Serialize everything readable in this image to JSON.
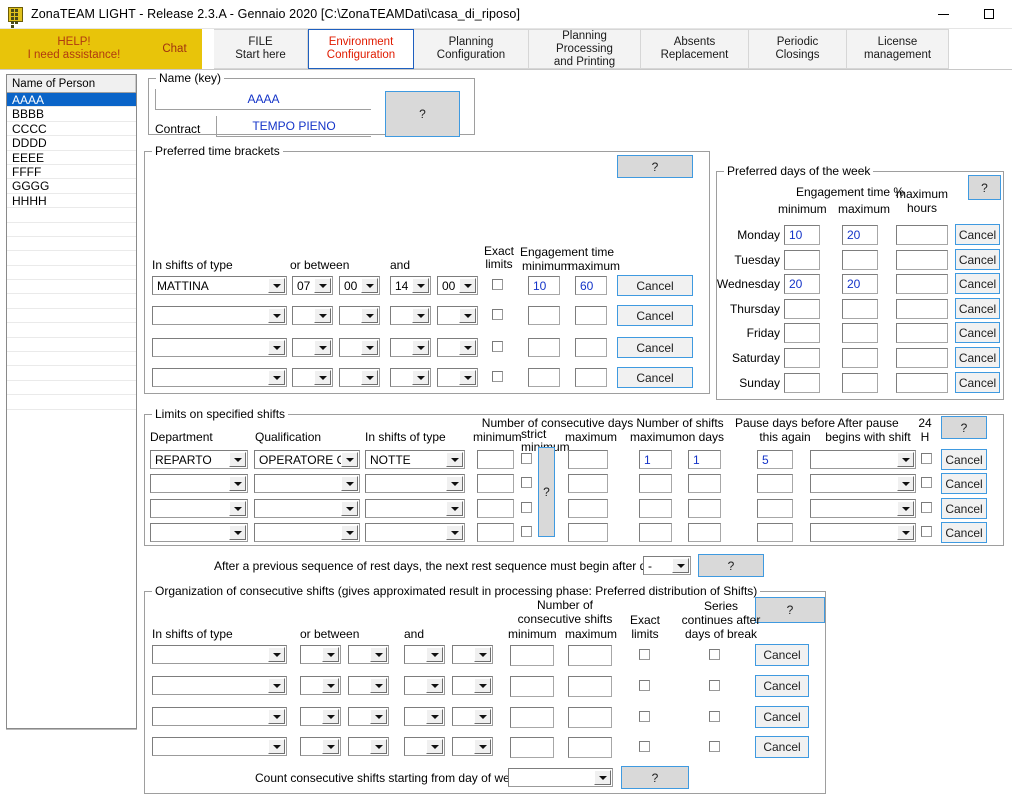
{
  "window": {
    "title": "ZonaTEAM LIGHT - Release 2.3.A - Gennaio 2020 [C:\\ZonaTEAMDati\\casa_di_riposo]",
    "icon": "app-icon",
    "minimize": "minimize-icon",
    "maximize": "maximize-icon"
  },
  "tabs": [
    {
      "label": "HELP!\nI need assistance!",
      "style": "gold"
    },
    {
      "label": "Chat",
      "style": "gold"
    },
    {
      "label": "FILE\nStart here",
      "style": "normal"
    },
    {
      "label": "Environment\nConfiguration",
      "style": "active"
    },
    {
      "label": "Planning Configuration",
      "style": "normal"
    },
    {
      "label": "Planning Processing\nand Printing",
      "style": "normal"
    },
    {
      "label": "Absents Replacement",
      "style": "normal"
    },
    {
      "label": "Periodic Closings",
      "style": "normal"
    },
    {
      "label": "License\nmanagement",
      "style": "normal"
    }
  ],
  "person_list": {
    "header": "Name of Person",
    "items": [
      "AAAA",
      "BBBB",
      "CCCC",
      "DDDD",
      "EEEE",
      "FFFF",
      "GGGG",
      "HHHH"
    ],
    "selected": "AAAA",
    "empty_rows": 14
  },
  "name_key": {
    "title": "Name (key)",
    "name_value": "AAAA",
    "contract_label": "Contract",
    "contract_value": "TEMPO PIENO",
    "help": "?"
  },
  "preferred_time_brackets": {
    "title": "Preferred time brackets",
    "help": "?",
    "headers": {
      "shift_type": "In shifts of type",
      "or_between": "or between",
      "and": "and",
      "exact_limits": "Exact\nlimits",
      "engagement_time": "Engagement time",
      "minimum": "minimum",
      "maximum": "maximum"
    },
    "cancel_label": "Cancel",
    "rows": [
      {
        "shift_type": "MATTINA",
        "from_h": "07",
        "from_m": "00",
        "to_h": "14",
        "to_m": "00",
        "exact": false,
        "min": "10",
        "max": "60"
      },
      {
        "shift_type": "",
        "from_h": "",
        "from_m": "",
        "to_h": "",
        "to_m": "",
        "exact": false,
        "min": "",
        "max": ""
      },
      {
        "shift_type": "",
        "from_h": "",
        "from_m": "",
        "to_h": "",
        "to_m": "",
        "exact": false,
        "min": "",
        "max": ""
      },
      {
        "shift_type": "",
        "from_h": "",
        "from_m": "",
        "to_h": "",
        "to_m": "",
        "exact": false,
        "min": "",
        "max": ""
      }
    ]
  },
  "preferred_days": {
    "title": "Preferred days of the week",
    "help": "?",
    "headers": {
      "engagement_pct": "Engagement time %",
      "minimum": "minimum",
      "maximum": "maximum",
      "max_hours": "maximum\nhours"
    },
    "cancel_label": "Cancel",
    "rows": [
      {
        "day": "Monday",
        "min": "10",
        "max": "20",
        "hours": ""
      },
      {
        "day": "Tuesday",
        "min": "",
        "max": "",
        "hours": ""
      },
      {
        "day": "Wednesday",
        "min": "20",
        "max": "20",
        "hours": ""
      },
      {
        "day": "Thursday",
        "min": "",
        "max": "",
        "hours": ""
      },
      {
        "day": "Friday",
        "min": "",
        "max": "",
        "hours": ""
      },
      {
        "day": "Saturday",
        "min": "",
        "max": "",
        "hours": ""
      },
      {
        "day": "Sunday",
        "min": "",
        "max": "",
        "hours": ""
      }
    ]
  },
  "limits_on_shifts": {
    "title": "Limits on specified shifts",
    "help": "?",
    "help_strict": "?",
    "headers": {
      "department": "Department",
      "qualification": "Qualification",
      "shift_type": "In shifts of type",
      "consecutive_days": "Number of consecutive days",
      "cd_minimum": "minimum",
      "strict_minimum": "strict\nminimum",
      "cd_maximum": "maximum",
      "number_of_shifts": "Number of shifts",
      "ns_maximum": "maximum",
      "ns_on_days": "on days",
      "pause_days": "Pause days before\nthis again",
      "after_pause": "After pause\nbegins with shift",
      "h24": "24\nH"
    },
    "cancel_label": "Cancel",
    "rows": [
      {
        "department": "REPARTO",
        "qualification": "OPERATORE OSS",
        "shift_type": "NOTTE",
        "cd_min": "",
        "strict": false,
        "cd_max": "",
        "ns_max": "1",
        "ns_days": "1",
        "pause": "5",
        "after_pause": "",
        "h24": false
      },
      {
        "department": "",
        "qualification": "",
        "shift_type": "",
        "cd_min": "",
        "strict": false,
        "cd_max": "",
        "ns_max": "",
        "ns_days": "",
        "pause": "",
        "after_pause": "",
        "h24": false
      },
      {
        "department": "",
        "qualification": "",
        "shift_type": "",
        "cd_min": "",
        "strict": false,
        "cd_max": "",
        "ns_max": "",
        "ns_days": "",
        "pause": "",
        "after_pause": "",
        "h24": false
      },
      {
        "department": "",
        "qualification": "",
        "shift_type": "",
        "cd_min": "",
        "strict": false,
        "cd_max": "",
        "ns_max": "",
        "ns_days": "",
        "pause": "",
        "after_pause": "",
        "h24": false
      }
    ]
  },
  "rest_sequence": {
    "label": "After a previous sequence of rest days, the next rest sequence must begin after days",
    "value": "-",
    "help": "?"
  },
  "consecutive_shifts": {
    "title": "Organization of consecutive shifts (gives approximated result in processing phase: Preferred distribution of Shifts)",
    "help": "?",
    "headers": {
      "shift_type": "In shifts of type",
      "or_between": "or between",
      "and": "and",
      "number_of": "Number of\nconsecutive shifts",
      "minimum": "minimum",
      "maximum": "maximum",
      "exact_limits": "Exact\nlimits",
      "series_continues": "Series\ncontinues after\ndays of break"
    },
    "cancel_label": "Cancel",
    "rows": [
      {
        "shift_type": "",
        "from_h": "",
        "from_m": "",
        "to_h": "",
        "to_m": "",
        "min": "",
        "max": "",
        "exact": false,
        "series": false
      },
      {
        "shift_type": "",
        "from_h": "",
        "from_m": "",
        "to_h": "",
        "to_m": "",
        "min": "",
        "max": "",
        "exact": false,
        "series": false
      },
      {
        "shift_type": "",
        "from_h": "",
        "from_m": "",
        "to_h": "",
        "to_m": "",
        "min": "",
        "max": "",
        "exact": false,
        "series": false
      },
      {
        "shift_type": "",
        "from_h": "",
        "from_m": "",
        "to_h": "",
        "to_m": "",
        "min": "",
        "max": "",
        "exact": false,
        "series": false
      }
    ],
    "footer": {
      "label": "Count consecutive shifts starting from day of week:",
      "value": "",
      "help": "?"
    }
  },
  "colors": {
    "gold": "#e8c40a",
    "help_text": "#b03a10",
    "active_tab_text": "#e01b00",
    "active_tab_border": "#1e5fbf",
    "field_value": "#1434c8",
    "selection": "#0a64c8",
    "button_border": "#3f9ae0"
  }
}
